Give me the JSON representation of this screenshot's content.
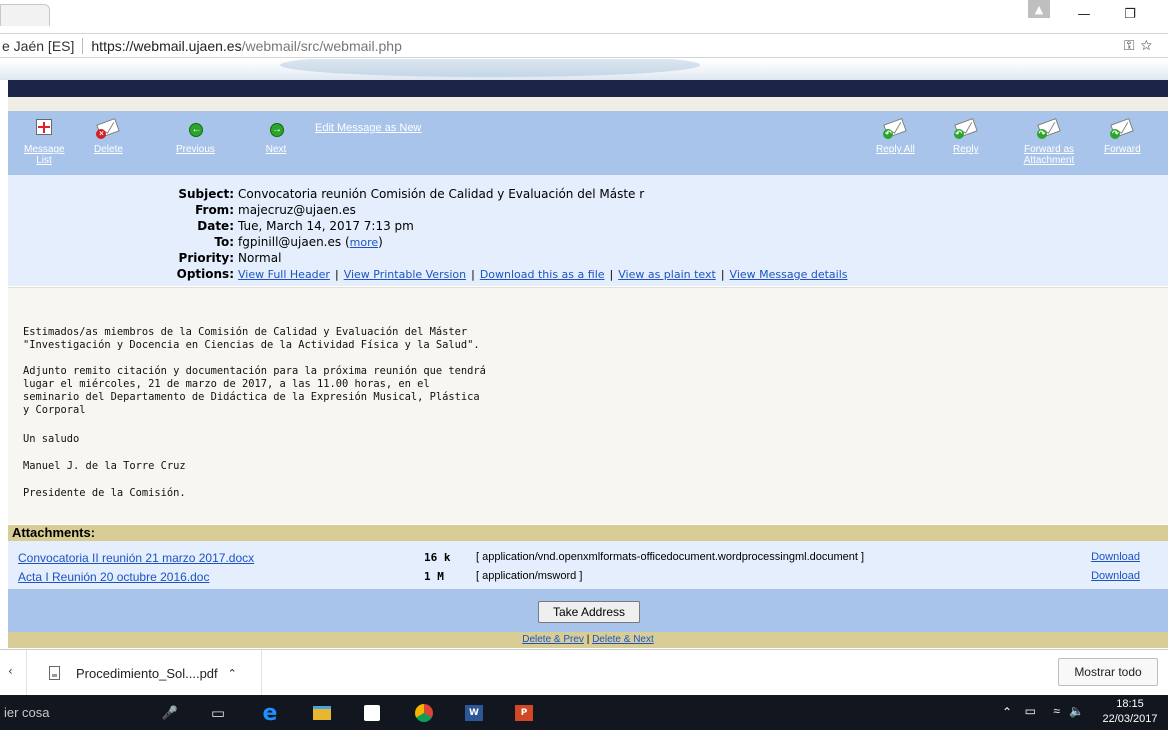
{
  "browser": {
    "site_label": "e Jaén [ES]",
    "url_host": "https://webmail.ujaen.es",
    "url_path": "/webmail/src/webmail.php"
  },
  "toolbar": {
    "message_list": "Message List",
    "delete": "Delete",
    "previous": "Previous",
    "next": "Next",
    "edit_as_new": "Edit Message as New",
    "reply_all": "Reply All",
    "reply": "Reply",
    "forward_as_attachment": "Forward as Attachment",
    "forward": "Forward"
  },
  "headers": {
    "subject_label": "Subject:",
    "subject": "Convocatoria reunión Comisión de Calidad y Evaluación del Máste r",
    "from_label": "From:",
    "from": "majecruz@ujaen.es",
    "date_label": "Date:",
    "date": "Tue, March 14, 2017 7:13 pm",
    "to_label": "To:",
    "to": "fgpinill@ujaen.es",
    "more": "more",
    "priority_label": "Priority:",
    "priority": "Normal",
    "options_label": "Options:",
    "options": [
      "View Full Header",
      "View Printable Version",
      "Download this as a file",
      "View as plain text",
      "View Message details"
    ]
  },
  "body_lines": [
    "Estimados/as miembros de la Comisión de Calidad y Evaluación del Máster",
    "\"Investigación y Docencia en Ciencias de la Actividad Física y la Salud\".",
    "Adjunto remito citación y documentación para la próxima reunión que tendrá",
    "lugar el miércoles, 21 de marzo de 2017, a las 11.00 horas, en el",
    "seminario del Departamento de Didáctica de la Expresión Musical, Plástica",
    "y Corporal",
    "Un saludo",
    "Manuel J. de la Torre Cruz",
    "Presidente de la Comisión."
  ],
  "attachments": {
    "heading": "Attachments:",
    "download_label": "Download",
    "items": [
      {
        "name": "Convocatoria  II  reunión  21  marzo  2017.docx",
        "size": "16 k",
        "type": "[ application/vnd.openxmlformats-officedocument.wordprocessingml.document ]"
      },
      {
        "name": "Acta  I  Reunión  20  octubre  2016.doc",
        "size": "1 M",
        "type": "[ application/msword ]"
      }
    ]
  },
  "take_address": "Take Address",
  "delete_prev": "Delete & Prev",
  "delete_next": "Delete & Next",
  "downloads": {
    "file": "Procedimiento_Sol....pdf",
    "show_all": "Mostrar todo"
  },
  "taskbar": {
    "search_text": "ier cosa",
    "time": "18:15",
    "date": "22/03/2017"
  },
  "colors": {
    "toolbar_blue": "#a8c4ea",
    "header_bg": "#e4eefc",
    "attachment_bar": "#d8cd95",
    "link": "#1d53c5"
  }
}
